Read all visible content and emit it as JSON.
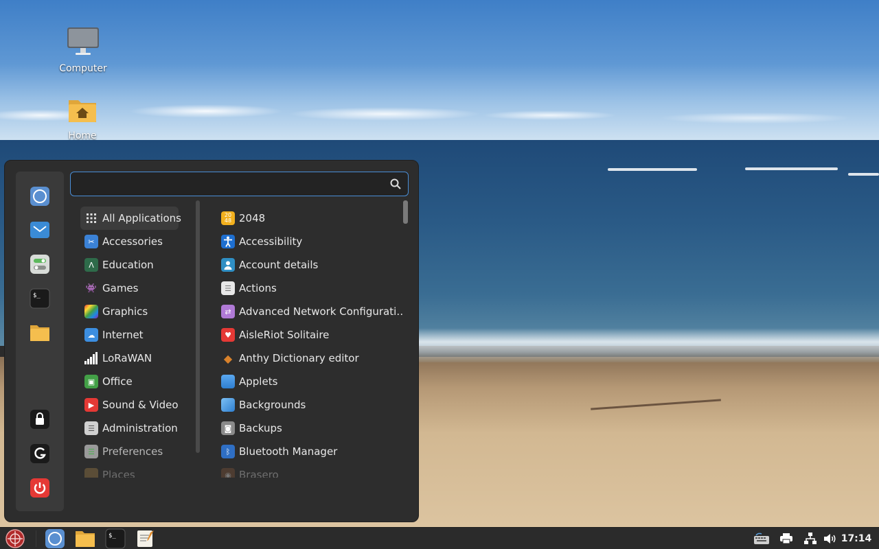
{
  "desktop": {
    "icons": [
      {
        "label": "Computer",
        "icon": "computer-icon"
      },
      {
        "label": "Home",
        "icon": "home-folder-icon"
      }
    ]
  },
  "menu": {
    "search": {
      "placeholder": "",
      "value": ""
    },
    "favorites": [
      "web-browser-icon",
      "mail-icon",
      "settings-toggle-icon",
      "terminal-icon",
      "folder-icon"
    ],
    "session": [
      "lock-icon",
      "logout-icon",
      "power-icon"
    ],
    "categories": [
      {
        "label": "All Applications",
        "icon": "grid-icon",
        "active": true
      },
      {
        "label": "Accessories",
        "icon": "scissors-icon"
      },
      {
        "label": "Education",
        "icon": "compass-icon"
      },
      {
        "label": "Games",
        "icon": "invader-icon"
      },
      {
        "label": "Graphics",
        "icon": "palette-icon"
      },
      {
        "label": "Internet",
        "icon": "cloud-icon"
      },
      {
        "label": "LoRaWAN",
        "icon": "signal-bars-icon"
      },
      {
        "label": "Office",
        "icon": "office-icon"
      },
      {
        "label": "Sound & Video",
        "icon": "play-icon"
      },
      {
        "label": "Administration",
        "icon": "admin-icon"
      },
      {
        "label": "Preferences",
        "icon": "preferences-icon"
      },
      {
        "label": "Places",
        "icon": "places-folder-icon"
      }
    ],
    "apps": [
      {
        "label": "2048",
        "icon": "game-2048-icon",
        "badge": "20\n48"
      },
      {
        "label": "Accessibility",
        "icon": "accessibility-icon"
      },
      {
        "label": "Account details",
        "icon": "user-icon"
      },
      {
        "label": "Actions",
        "icon": "list-icon"
      },
      {
        "label": "Advanced Network Configurati…",
        "icon": "network-arrows-icon"
      },
      {
        "label": "AisleRiot Solitaire",
        "icon": "heart-card-icon"
      },
      {
        "label": "Anthy Dictionary editor",
        "icon": "dictionary-icon"
      },
      {
        "label": "Applets",
        "icon": "applets-icon"
      },
      {
        "label": "Backgrounds",
        "icon": "backgrounds-icon"
      },
      {
        "label": "Backups",
        "icon": "backup-icon"
      },
      {
        "label": "Bluetooth Manager",
        "icon": "bluetooth-icon"
      },
      {
        "label": "Brasero",
        "icon": "disc-burner-icon"
      }
    ]
  },
  "taskbar": {
    "clock": "17:14",
    "launchers": [
      "menu-logo-icon",
      "web-browser-icon",
      "file-manager-icon",
      "terminal-icon",
      "text-editor-icon"
    ],
    "tray": [
      "keyboard-icon",
      "printer-icon",
      "network-icon",
      "volume-icon"
    ]
  },
  "colors": {
    "accent": "#4a8fd8",
    "panel": "#2b2b2b",
    "menu_bg": "#2d2d2d",
    "power_red": "#e53935"
  }
}
